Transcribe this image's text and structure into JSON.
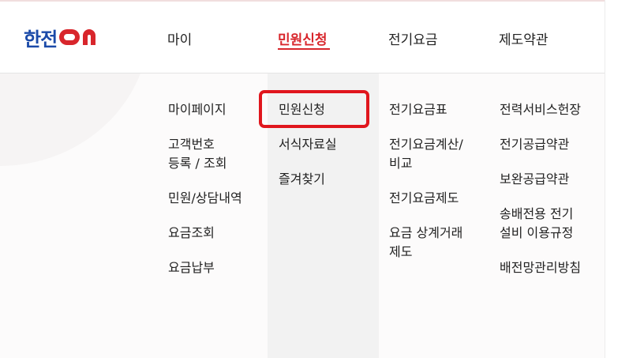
{
  "brand": {
    "logo_text": "한전",
    "logo_mark": "ON",
    "logo_color": "#1b4aa8"
  },
  "gnb": {
    "items": [
      {
        "label": "마이"
      },
      {
        "label": "민원신청",
        "active": true
      },
      {
        "label": "전기요금"
      },
      {
        "label": "제도약관"
      }
    ]
  },
  "menu": {
    "my": [
      "마이페이지",
      "고객번호",
      "등록 / 조회",
      "민원/상담내역",
      "요금조회",
      "요금납부"
    ],
    "apply": [
      "민원신청",
      "서식자료실",
      "즐겨찾기"
    ],
    "charge": [
      "전기요금표",
      "전기요금계산/",
      "비교",
      "전기요금제도",
      "요금 상계거래",
      "제도"
    ],
    "policy": [
      "전력서비스헌장",
      "전기공급약관",
      "보완공급약관",
      "송배전용 전기",
      "설비 이용규정",
      "배전망관리방침"
    ]
  },
  "colors": {
    "accent": "#d8262c",
    "highlight": "#e0161d"
  }
}
